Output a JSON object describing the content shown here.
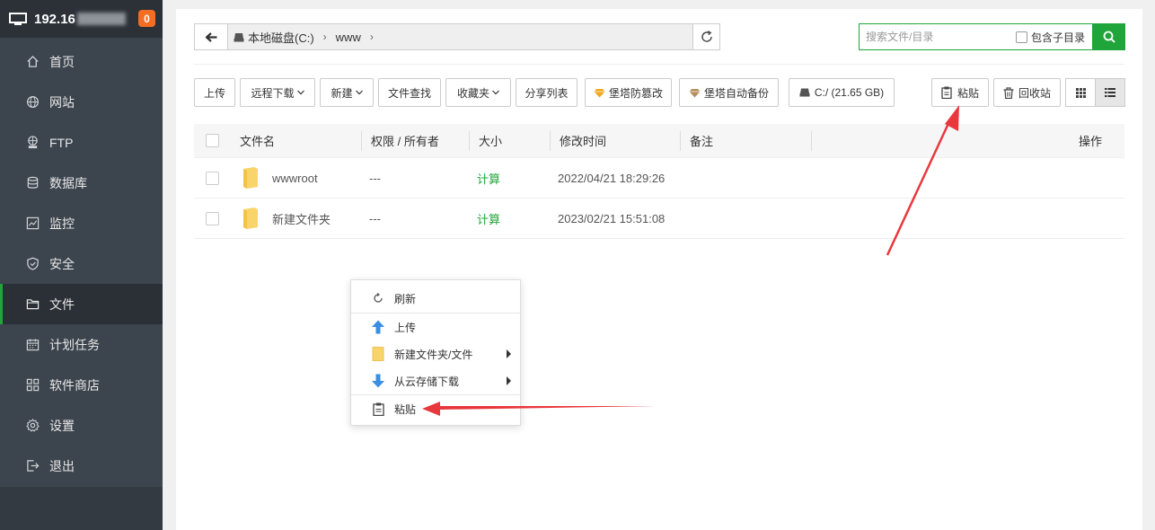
{
  "sidebar": {
    "host": "192.16",
    "badge": "0",
    "items": [
      {
        "label": "首页",
        "icon": "home-icon"
      },
      {
        "label": "网站",
        "icon": "globe-icon"
      },
      {
        "label": "FTP",
        "icon": "ftp-icon"
      },
      {
        "label": "数据库",
        "icon": "database-icon"
      },
      {
        "label": "监控",
        "icon": "monitor-chart-icon"
      },
      {
        "label": "安全",
        "icon": "shield-icon"
      },
      {
        "label": "文件",
        "icon": "folder-icon"
      },
      {
        "label": "计划任务",
        "icon": "calendar-icon"
      },
      {
        "label": "软件商店",
        "icon": "grid-icon"
      },
      {
        "label": "设置",
        "icon": "gear-icon"
      },
      {
        "label": "退出",
        "icon": "logout-icon"
      }
    ],
    "active": "文件"
  },
  "pathbar": {
    "segments": [
      "本地磁盘(C:)",
      "www"
    ]
  },
  "search": {
    "placeholder": "搜索文件/目录",
    "include_sub": "包含子目录"
  },
  "toolbar": {
    "upload": "上传",
    "remote_download": "远程下载",
    "new": "新建",
    "find": "文件查找",
    "favorites": "收藏夹",
    "share_list": "分享列表",
    "tamper": "堡塔防篡改",
    "auto_backup": "堡塔自动备份",
    "disk": "C:/ (21.65 GB)",
    "paste": "粘贴",
    "recycle": "回收站"
  },
  "table": {
    "headers": {
      "name": "文件名",
      "perm": "权限 / 所有者",
      "size": "大小",
      "mtime": "修改时间",
      "note": "备注",
      "ops": "操作"
    },
    "rows": [
      {
        "name": "wwwroot",
        "perm": "---",
        "size": "计算",
        "mtime": "2022/04/21 18:29:26"
      },
      {
        "name": "新建文件夹",
        "perm": "---",
        "size": "计算",
        "mtime": "2023/02/21 15:51:08"
      }
    ]
  },
  "context_menu": {
    "refresh": "刷新",
    "upload": "上传",
    "new_folder_file": "新建文件夹/文件",
    "cloud_download": "从云存储下载",
    "paste": "粘贴"
  },
  "colors": {
    "accent": "#20a53a",
    "sidebar_bg": "#3c444d",
    "badge": "#f36d22",
    "annotation_arrow": "#e8383d"
  }
}
